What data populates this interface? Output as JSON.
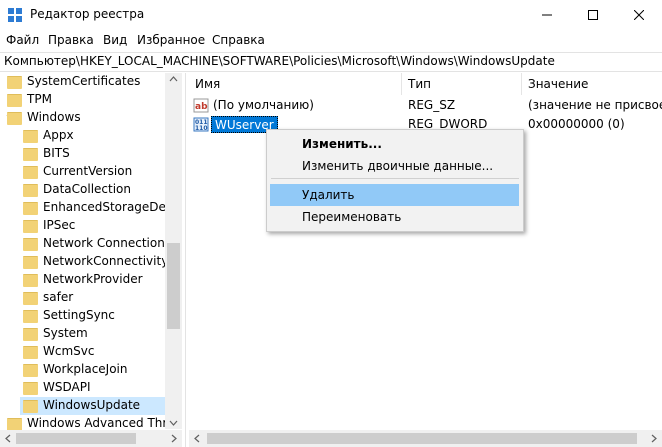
{
  "window": {
    "title": "Редактор реестра"
  },
  "menu": [
    "Файл",
    "Правка",
    "Вид",
    "Избранное",
    "Справка"
  ],
  "address": "Компьютер\\HKEY_LOCAL_MACHINE\\SOFTWARE\\Policies\\Microsoft\\Windows\\WindowsUpdate",
  "tree": {
    "items": [
      {
        "label": "SystemCertificates",
        "level": 0,
        "expandable": true
      },
      {
        "label": "TPM",
        "level": 0,
        "expandable": false
      },
      {
        "label": "Windows",
        "level": 0,
        "expandable": true,
        "expanded": true
      },
      {
        "label": "Appx",
        "level": 1,
        "expandable": false
      },
      {
        "label": "BITS",
        "level": 1,
        "expandable": false
      },
      {
        "label": "CurrentVersion",
        "level": 1,
        "expandable": true
      },
      {
        "label": "DataCollection",
        "level": 1,
        "expandable": false
      },
      {
        "label": "EnhancedStorageDevic",
        "level": 1,
        "expandable": false
      },
      {
        "label": "IPSec",
        "level": 1,
        "expandable": true
      },
      {
        "label": "Network Connections",
        "level": 1,
        "expandable": false
      },
      {
        "label": "NetworkConnectivitySt",
        "level": 1,
        "expandable": false
      },
      {
        "label": "NetworkProvider",
        "level": 1,
        "expandable": true
      },
      {
        "label": "safer",
        "level": 1,
        "expandable": true
      },
      {
        "label": "SettingSync",
        "level": 1,
        "expandable": false
      },
      {
        "label": "System",
        "level": 1,
        "expandable": false
      },
      {
        "label": "WcmSvc",
        "level": 1,
        "expandable": true
      },
      {
        "label": "WorkplaceJoin",
        "level": 1,
        "expandable": false
      },
      {
        "label": "WSDAPI",
        "level": 1,
        "expandable": true
      },
      {
        "label": "WindowsUpdate",
        "level": 1,
        "expandable": false,
        "selected": true
      },
      {
        "label": "Windows Advanced Threa",
        "level": 0,
        "expandable": true
      }
    ]
  },
  "values_table": {
    "headers": [
      "Имя",
      "Тип",
      "Значение"
    ],
    "rows": [
      {
        "name": "(По умолчанию)",
        "type": "REG_SZ",
        "value": "(значение не присвоено)",
        "icon": "string-value-icon"
      },
      {
        "name": "WUserver",
        "type": "REG_DWORD",
        "value": "0x00000000 (0)",
        "icon": "binary-value-icon",
        "selected": true
      }
    ]
  },
  "context_menu": {
    "items": [
      "Изменить...",
      "Изменить двоичные данные...",
      "Удалить",
      "Переименовать"
    ],
    "hovered": "Удалить"
  },
  "colors": {
    "selection": "#0078d7",
    "tree_selection": "#cce8ff",
    "menu_hover": "#91c9f7"
  }
}
